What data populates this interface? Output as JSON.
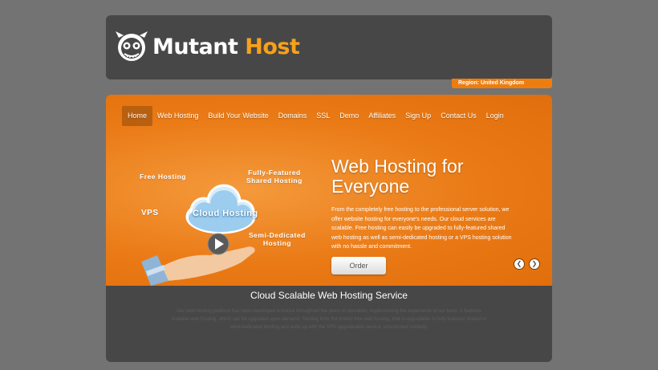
{
  "logo": {
    "word1": "Mutant",
    "word2": "Host"
  },
  "region": "Region: United Kingdom",
  "nav": [
    {
      "label": "Home",
      "active": true
    },
    {
      "label": "Web Hosting"
    },
    {
      "label": "Build Your Website"
    },
    {
      "label": "Domains"
    },
    {
      "label": "SSL"
    },
    {
      "label": "Demo"
    },
    {
      "label": "Affiliates"
    },
    {
      "label": "Sign Up"
    },
    {
      "label": "Contact Us"
    },
    {
      "label": "Login"
    }
  ],
  "illustration": {
    "free_hosting": "Free Hosting",
    "fully_featured_1": "Fully-Featured",
    "fully_featured_2": "Shared Hosting",
    "vps": "VPS",
    "cloud": "Cloud Hosting",
    "semi_dedicated_1": "Semi-Dedicated",
    "semi_dedicated_2": "Hosting"
  },
  "headline": {
    "line1": "Web Hosting for",
    "line2": "Everyone"
  },
  "body": "From the completely free hosting to the professional server solution, we offer website hosting for everyone's needs. Our cloud services are scalable. Free hosting can easily be upgraded to fully-featured shared web hosting as well as semi-dedicated hosting or a VPS hosting solution with no hassle and commitment.",
  "order_label": "Order",
  "arrows": {
    "prev": "❮",
    "next": "❯"
  },
  "section": {
    "title": "Cloud Scalable Web Hosting Service",
    "text": "Our web hosting platform has been developed in-house throughout the years of operation, implementing the experience of our team. It features scalable web hosting, which can be upgraded upon demand. Starting from the limited free web hosting, that is upgradable to fully-featured shared or semi-dedicated hosting and ends up with the VPS upgradeable service, provisioned instantly."
  },
  "colors": {
    "accent": "#ee7d10",
    "logo_orange": "#f7a11a",
    "panel": "#474747"
  }
}
